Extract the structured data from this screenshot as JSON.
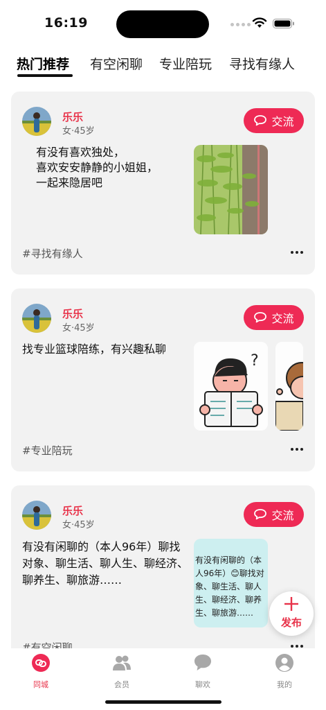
{
  "status_bar": {
    "time": "16:19"
  },
  "tabs": [
    {
      "label": "热门推荐",
      "active": true
    },
    {
      "label": "有空闲聊",
      "active": false
    },
    {
      "label": "专业陪玩",
      "active": false
    },
    {
      "label": "寻找有缘人",
      "active": false
    }
  ],
  "posts": [
    {
      "user": {
        "name": "乐乐",
        "meta": "女·45岁"
      },
      "chat_label": "交流",
      "text": "有没有喜欢独处，\n喜欢安安静静的小姐姐，\n一起来隐居吧",
      "tag": "#寻找有缘人"
    },
    {
      "user": {
        "name": "乐乐",
        "meta": "女·45岁"
      },
      "chat_label": "交流",
      "text": "找专业篮球陪练，有兴趣私聊",
      "tag": "#专业陪玩"
    },
    {
      "user": {
        "name": "乐乐",
        "meta": "女·45岁"
      },
      "chat_label": "交流",
      "text": "有没有闲聊的（本人96年）聊找对象、聊生活、聊人生、聊经济、聊养生、聊旅游……",
      "image_text": "有没有闲聊的（本人96年）😊聊找对象、聊生活、聊人生、聊经济、聊养生、聊旅游……",
      "tag": "#有空闲聊"
    }
  ],
  "publish": {
    "label": "发布"
  },
  "bottom_nav": [
    {
      "label": "同城",
      "icon": "city-icon",
      "active": true
    },
    {
      "label": "会员",
      "icon": "members-icon",
      "active": false
    },
    {
      "label": "聊欢",
      "icon": "chat-bubble-icon",
      "active": false
    },
    {
      "label": "我的",
      "icon": "profile-icon",
      "active": false
    }
  ],
  "colors": {
    "accent": "#ee2a55",
    "name": "#e8334a",
    "card_bg": "#f2f2f2"
  }
}
